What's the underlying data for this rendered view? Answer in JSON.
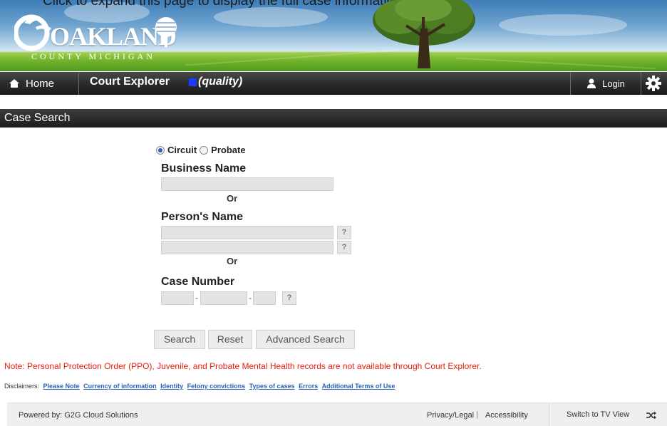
{
  "banner": {
    "top_text": "Click to expand this page to display the full case information",
    "logo_word": "OAKLAND",
    "logo_sub": "COUNTY MICHIGAN"
  },
  "nav": {
    "home_label": "Home",
    "title": "Court Explorer",
    "environment": "(quality)",
    "environment_color": "#1a3cff",
    "login_label": "Login"
  },
  "section": {
    "title": "Case Search"
  },
  "form": {
    "court_options": [
      {
        "label": "Circuit",
        "selected": true
      },
      {
        "label": "Probate",
        "selected": false
      }
    ],
    "business_name_label": "Business Name",
    "business_name_value": "",
    "or_label": "Or",
    "persons_name_label": "Person's Name",
    "persons_name_value_1": "",
    "persons_name_value_2": "",
    "case_number_label": "Case Number",
    "case_number_dash": "-",
    "help_symbol": "?"
  },
  "buttons": {
    "search": "Search",
    "reset": "Reset",
    "advanced_search": "Advanced Search"
  },
  "note": "Note: Personal Protection Order (PPO), Juvenile, and Probate Mental Health records are not available through Court Explorer.",
  "disclaimers": {
    "label": "Disclaimers:",
    "links": [
      "Please Note",
      "Currency of information",
      "Identity",
      "Felony convictions",
      "Types of cases",
      "Errors",
      "Additional Terms of Use"
    ]
  },
  "footer": {
    "powered_by": "Powered by: G2G Cloud Solutions",
    "privacy": "Privacy/Legal",
    "separator": "|",
    "accessibility": "Accessibility",
    "tv_view": "Switch to TV View"
  },
  "colors": {
    "note_text": "#e8200f",
    "link": "#2a62b8",
    "nav_bg": "#2c2c2c"
  }
}
